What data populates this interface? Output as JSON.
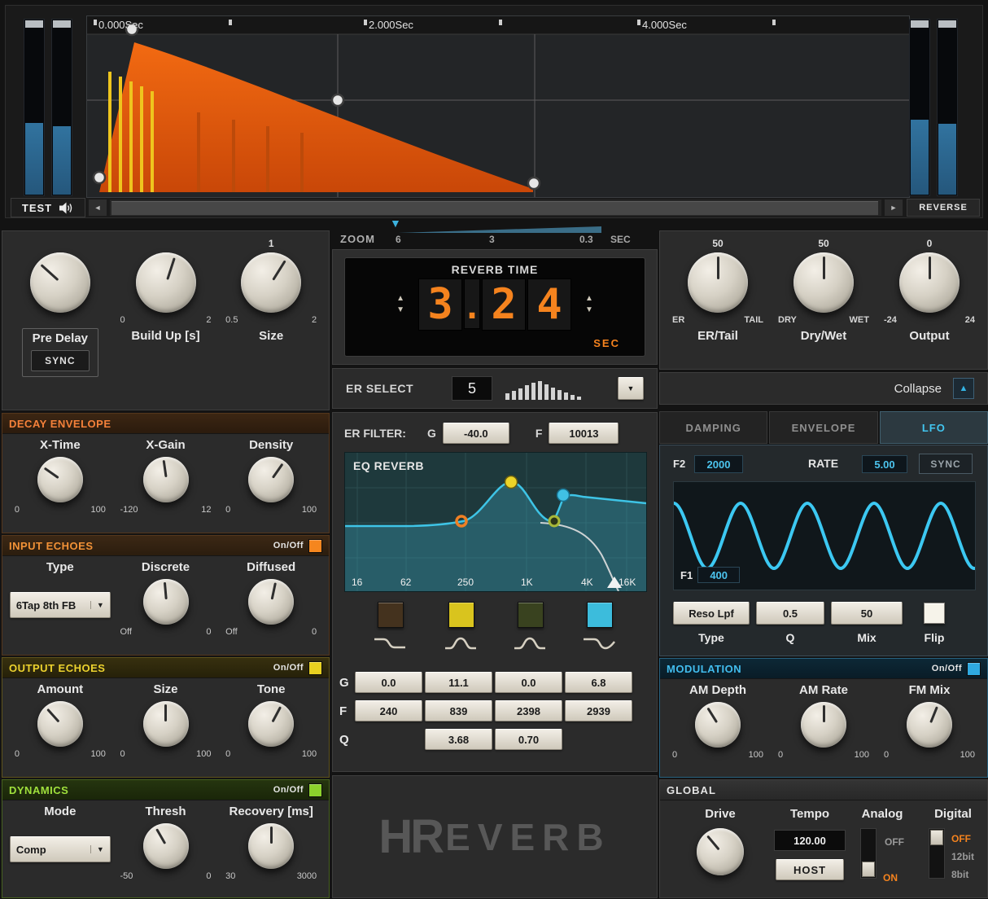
{
  "visualizer": {
    "ruler_labels": [
      "0.000Sec",
      "2.000Sec",
      "4.000Sec"
    ],
    "test_button": "TEST",
    "reverse_button": "REVERSE"
  },
  "zoom": {
    "label": "ZOOM",
    "ticks": [
      "6",
      "3",
      "0.3"
    ],
    "unit": "SEC"
  },
  "left_panel": {
    "main_knobs": {
      "pre_delay": {
        "label": "Pre Delay",
        "sync_button": "SYNC"
      },
      "build_up": {
        "label": "Build Up [s]",
        "min": "0",
        "max": "2"
      },
      "size": {
        "label": "Size",
        "value_top": "1",
        "min": "0.5",
        "max": "2"
      }
    },
    "decay_envelope": {
      "title": "DECAY ENVELOPE",
      "knobs": [
        {
          "label": "X-Time",
          "min": "0",
          "max": "100"
        },
        {
          "label": "X-Gain",
          "min": "-120",
          "max": "12"
        },
        {
          "label": "Density",
          "min": "0",
          "max": "100"
        }
      ]
    },
    "input_echoes": {
      "title": "INPUT ECHOES",
      "onoff_label": "On/Off",
      "onoff_color": "#f5861e",
      "type_label": "Type",
      "type_value": "6Tap 8th FB",
      "knobs": [
        {
          "label": "Discrete",
          "min": "Off",
          "max": "0"
        },
        {
          "label": "Diffused",
          "min": "Off",
          "max": "0"
        }
      ]
    },
    "output_echoes": {
      "title": "OUTPUT ECHOES",
      "onoff_label": "On/Off",
      "onoff_color": "#e8d020",
      "knobs": [
        {
          "label": "Amount",
          "min": "0",
          "max": "100"
        },
        {
          "label": "Size",
          "min": "0",
          "max": "100"
        },
        {
          "label": "Tone",
          "min": "0",
          "max": "100"
        }
      ]
    },
    "dynamics": {
      "title": "DYNAMICS",
      "onoff_label": "On/Off",
      "onoff_color": "#8cd22c",
      "mode_label": "Mode",
      "mode_value": "Comp",
      "knobs": [
        {
          "label": "Thresh",
          "min": "-50",
          "max": "0"
        },
        {
          "label": "Recovery [ms]",
          "min": "30",
          "max": "3000"
        }
      ]
    }
  },
  "center_panel": {
    "reverb_time": {
      "title": "REVERB TIME",
      "digits": [
        "3",
        ".",
        "2",
        "4"
      ],
      "unit": "SEC"
    },
    "er_select": {
      "label": "ER SELECT",
      "value": "5"
    },
    "er_filter": {
      "label": "ER FILTER:",
      "g_label": "G",
      "g_value": "-40.0",
      "f_label": "F",
      "f_value": "10013"
    },
    "eq": {
      "title": "EQ REVERB",
      "freq_labels": [
        "16",
        "62",
        "250",
        "1K",
        "4K",
        "16K"
      ],
      "band_colors": [
        "#44321e",
        "#d9c41e",
        "#39421f",
        "#3cbcdc"
      ],
      "g_row": {
        "label": "G",
        "values": [
          "0.0",
          "11.1",
          "0.0",
          "6.8"
        ]
      },
      "f_row": {
        "label": "F",
        "values": [
          "240",
          "839",
          "2398",
          "2939"
        ]
      },
      "q_row": {
        "label": "Q",
        "values": [
          "3.68",
          "0.70"
        ]
      }
    },
    "logo": {
      "hr": "HR",
      "rest": "EVERB"
    }
  },
  "right_panel": {
    "main_knobs": {
      "er_tail": {
        "label": "ER/Tail",
        "value_top": "50",
        "min": "ER",
        "max": "TAIL"
      },
      "dry_wet": {
        "label": "Dry/Wet",
        "value_top": "50",
        "min": "DRY",
        "max": "WET"
      },
      "output": {
        "label": "Output",
        "value_top": "0",
        "min": "-24",
        "max": "24"
      }
    },
    "collapse_label": "Collapse",
    "tabs": [
      "DAMPING",
      "ENVELOPE",
      "LFO"
    ],
    "lfo": {
      "f2_label": "F2",
      "f2_value": "2000",
      "rate_label": "RATE",
      "rate_value": "5.00",
      "sync_button": "SYNC",
      "f1_label": "F1",
      "f1_value": "400",
      "type_value": "Reso Lpf",
      "q_value": "0.5",
      "mix_value": "50",
      "col_labels": [
        "Type",
        "Q",
        "Mix",
        "Flip"
      ]
    },
    "modulation": {
      "title": "MODULATION",
      "onoff_label": "On/Off",
      "onoff_color": "#2fa9e0",
      "knobs": [
        {
          "label": "AM Depth",
          "min": "0",
          "max": "100"
        },
        {
          "label": "AM Rate",
          "min": "0",
          "max": "100"
        },
        {
          "label": "FM Mix",
          "min": "0",
          "max": "100"
        }
      ]
    },
    "global": {
      "title": "GLOBAL",
      "drive_label": "Drive",
      "tempo_label": "Tempo",
      "tempo_value": "120.00",
      "host_button": "HOST",
      "analog_label": "Analog",
      "analog_off": "OFF",
      "analog_on": "ON",
      "digital_label": "Digital",
      "digital_options": [
        "OFF",
        "12bit",
        "8bit"
      ]
    }
  }
}
